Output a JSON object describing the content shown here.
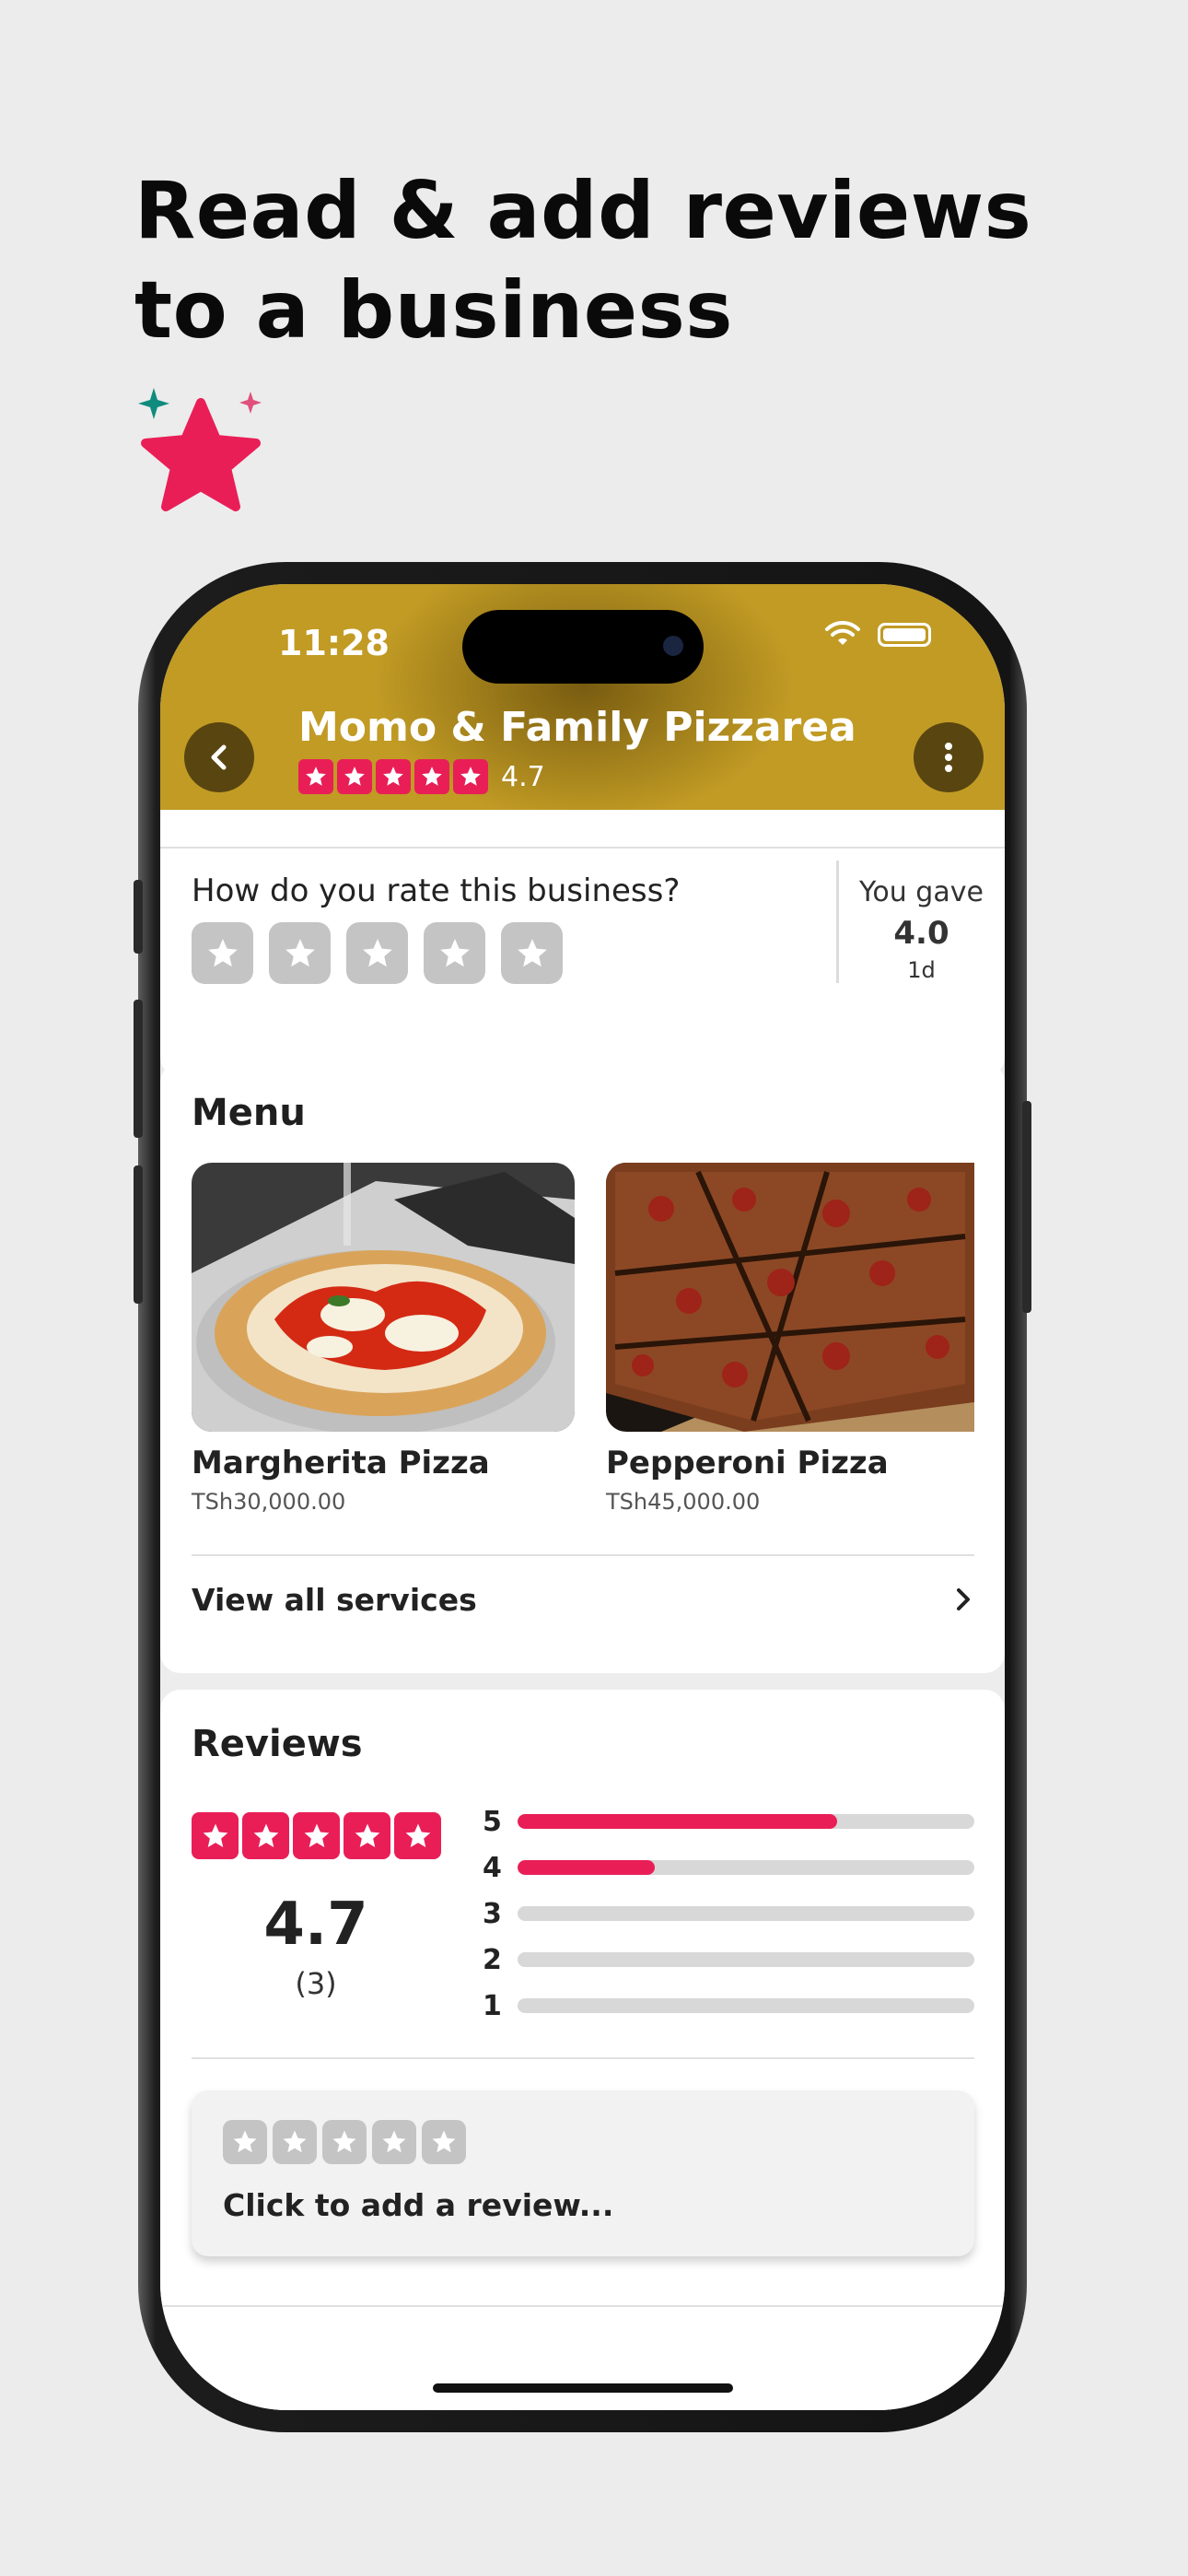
{
  "promo": {
    "headline_line1": "Read & add reviews",
    "headline_line2": "to a business",
    "icon": "sparkle-star-icon"
  },
  "status_bar": {
    "time": "11:28"
  },
  "business": {
    "name": "Momo & Family Pizzarea",
    "rating": "4.7",
    "rating_stars": 5
  },
  "rate_prompt": {
    "question": "How do you rate this business?",
    "you_gave_label": "You gave",
    "you_gave_value": "4.0",
    "you_gave_time": "1d"
  },
  "menu": {
    "title": "Menu",
    "items": [
      {
        "name": "Margherita Pizza",
        "price": "TSh30,000.00"
      },
      {
        "name": "Pepperoni Pizza",
        "price": "TSh45,000.00"
      }
    ],
    "view_all_label": "View all services"
  },
  "reviews": {
    "title": "Reviews",
    "average": "4.7",
    "count": "(3)",
    "distribution": [
      {
        "stars": "5",
        "fraction": 0.7
      },
      {
        "stars": "4",
        "fraction": 0.3
      },
      {
        "stars": "3",
        "fraction": 0
      },
      {
        "stars": "2",
        "fraction": 0
      },
      {
        "stars": "1",
        "fraction": 0
      }
    ],
    "add_review_placeholder": "Click to add a review..."
  },
  "colors": {
    "accent": "#e91e57",
    "header_bg": "#c19b24",
    "star_inactive": "#c4c4c4"
  }
}
